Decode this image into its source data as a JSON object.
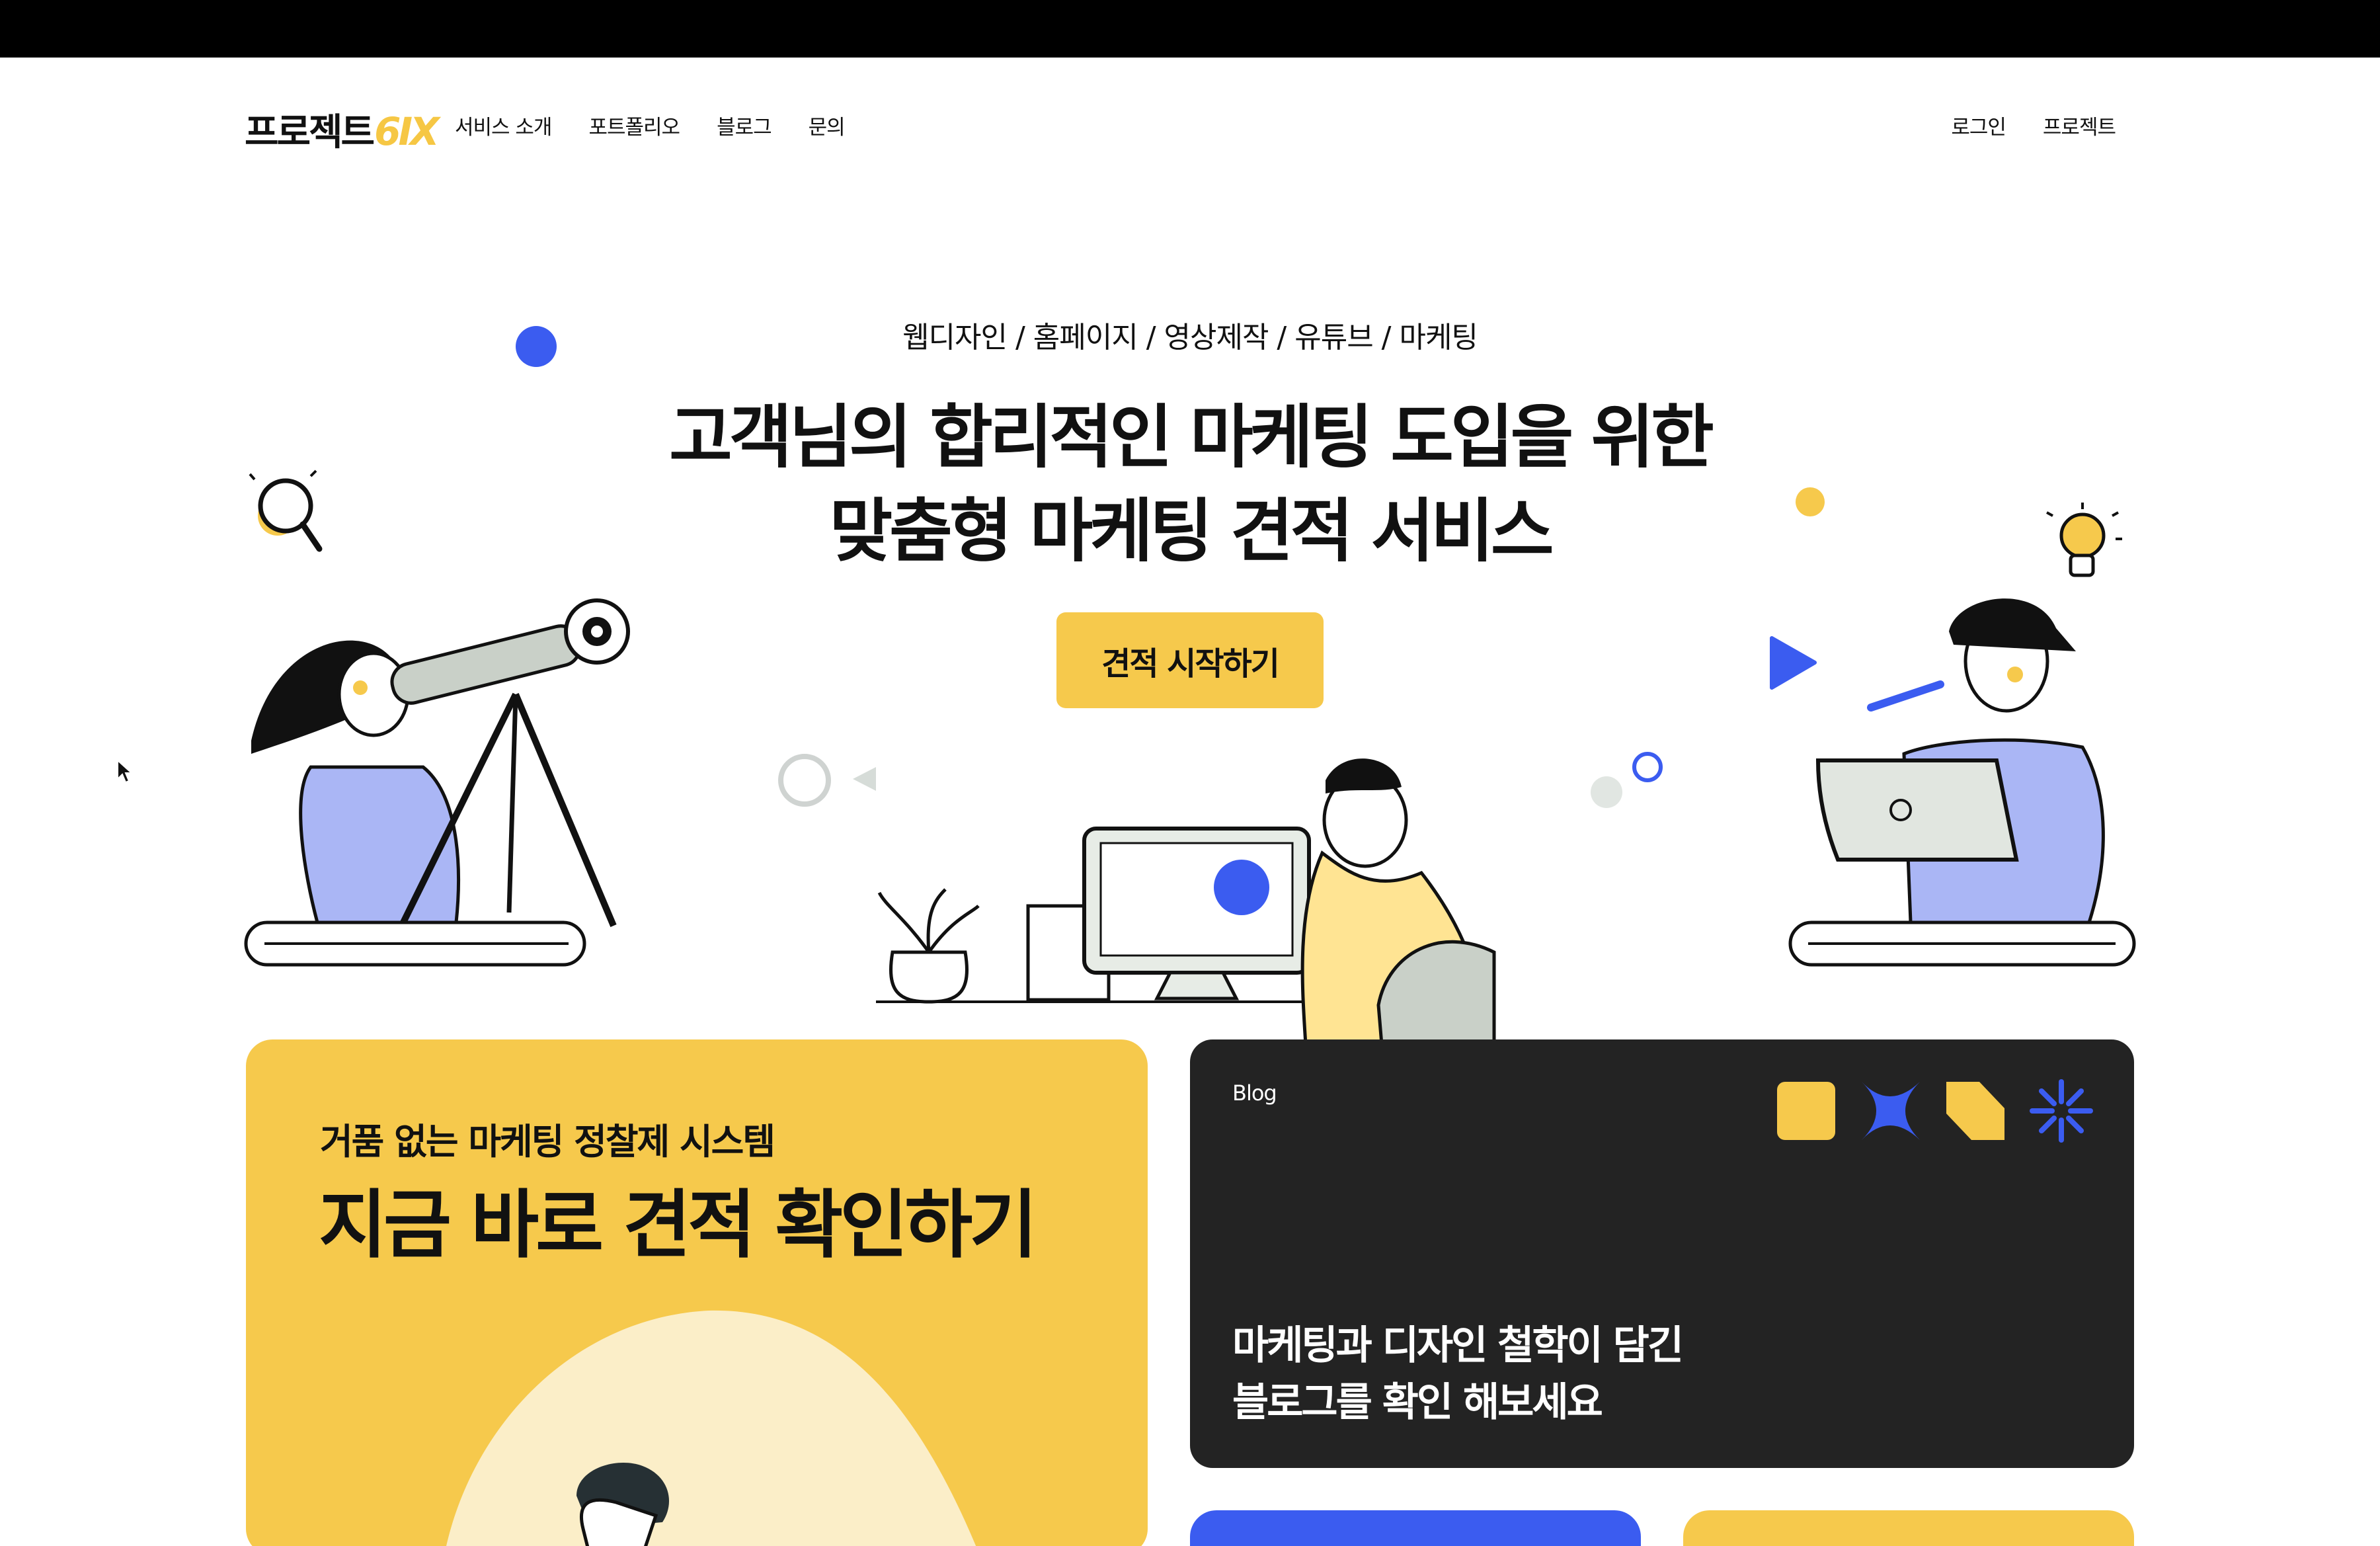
{
  "header": {
    "logo_ko": "프로젝트",
    "logo_en": "6IX",
    "nav": [
      "서비스 소개",
      "포트폴리오",
      "블로그",
      "문의"
    ],
    "nav_right": [
      "로그인",
      "프로젝트"
    ]
  },
  "hero": {
    "categories": "웹디자인  /  홈페이지  /  영상제작  /  유튜브  /  마케팅",
    "title_line1_a": "고객님의 ",
    "title_line1_b": "합리적인",
    "title_line1_c": " 마케팅 도입을 위한",
    "title_line2": "맞춤형 마케팅 견적 서비스",
    "cta": "견적 시작하기"
  },
  "cards": {
    "quote": {
      "sub": "거품 없는 마케팅 정찰제 시스템",
      "title": "지금 바로 견적 확인하기"
    },
    "blog": {
      "tag": "Blog",
      "line1": "마케팅과 디자인 철학이 담긴",
      "line2": "블로그를 확인 해보세요"
    }
  },
  "colors": {
    "accent_yellow": "#f6c94c",
    "accent_blue": "#3b5cf0",
    "dark": "#232323"
  }
}
